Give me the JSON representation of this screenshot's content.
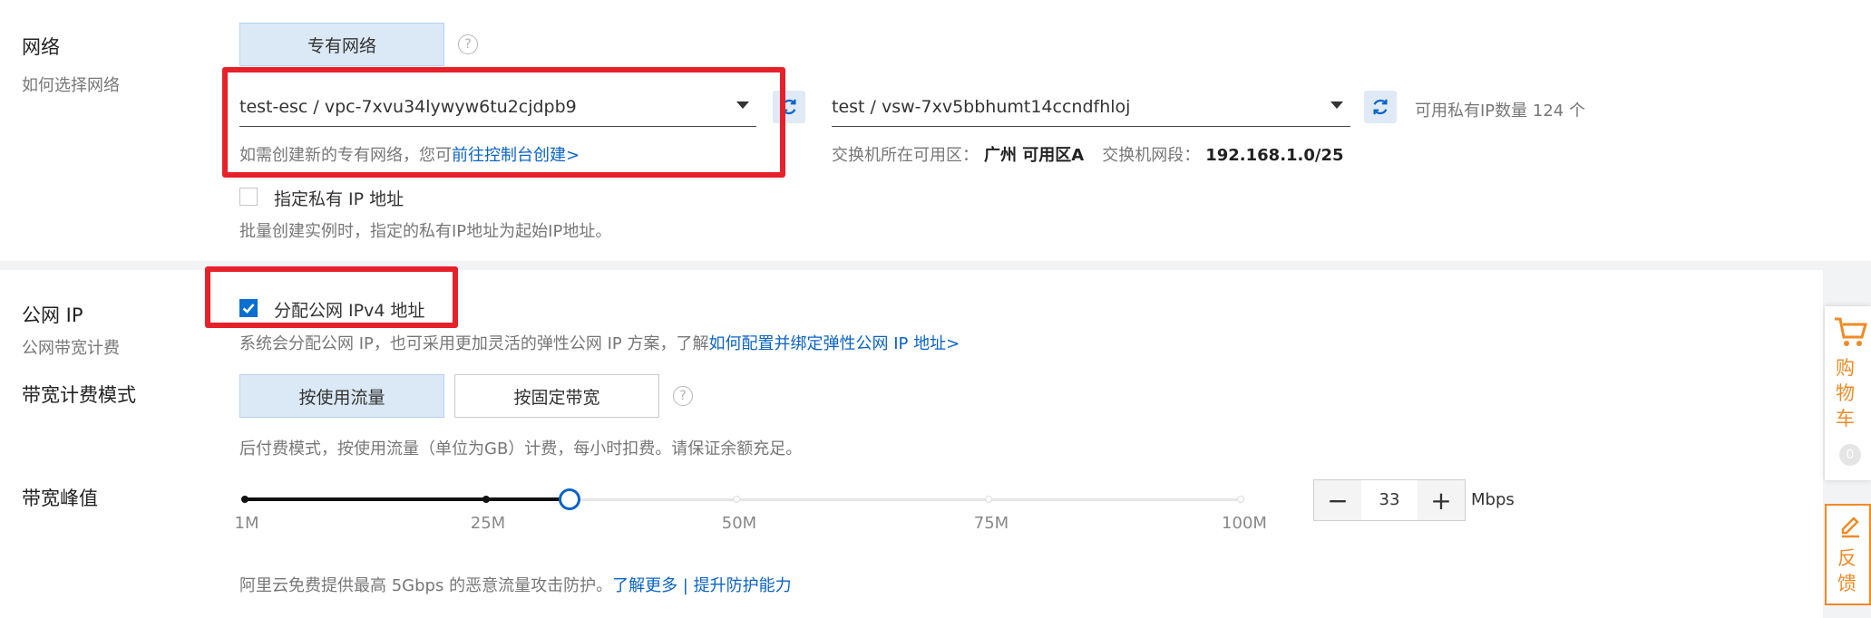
{
  "network": {
    "label": "网络",
    "sublabel": "如何选择网络",
    "type_button": "专有网络",
    "help": "?",
    "vpc_value": "test-esc / vpc-7xvu34lywyw6tu2cjdpb9",
    "vpc_hint_prefix": "如需创建新的专有网络，您可",
    "vpc_hint_link": "前往控制台创建>",
    "vswitch_value": "test / vsw-7xv5bbhumt14ccndfhloj",
    "available_ip_text": "可用私有IP数量 124 个",
    "zone_label": "交换机所在可用区：",
    "zone_value": "广州 可用区A",
    "cidr_label": "交换机网段：",
    "cidr_value": "192.168.1.0/25",
    "private_ip_checkbox_label": "指定私有 IP 地址",
    "private_ip_hint": "批量创建实例时，指定的私有IP地址为起始IP地址。"
  },
  "public_ip": {
    "label": "公网 IP",
    "sublabel": "公网带宽计费",
    "assign_checkbox_label": "分配公网 IPv4 地址",
    "assign_checked": true,
    "hint_prefix": "系统会分配公网 IP，也可采用更加灵活的弹性公网 IP 方案，了解",
    "hint_link": "如何配置并绑定弹性公网 IP 地址>"
  },
  "billing": {
    "label": "带宽计费模式",
    "options": [
      "按使用流量",
      "按固定带宽"
    ],
    "selected": "按使用流量",
    "help": "?",
    "hint": "后付费模式，按使用流量（单位为GB）计费，每小时扣费。请保证余额充足。"
  },
  "bandwidth": {
    "label": "带宽峰值",
    "ticks": [
      "1M",
      "25M",
      "50M",
      "75M",
      "100M"
    ],
    "value": 33,
    "minus": "−",
    "plus": "+",
    "unit": "Mbps",
    "footer_prefix": "阿里云免费提供最高 5Gbps 的恶意流量攻击防护。",
    "footer_link1": "了解更多",
    "footer_sep": " | ",
    "footer_link2": "提升防护能力"
  },
  "side": {
    "cart_label": "购物车",
    "cart_count": "0",
    "feedback_label": "反馈"
  },
  "colors": {
    "accent": "#0a64c8",
    "highlight_box": "#e6212a",
    "side_orange": "#f08a24"
  }
}
